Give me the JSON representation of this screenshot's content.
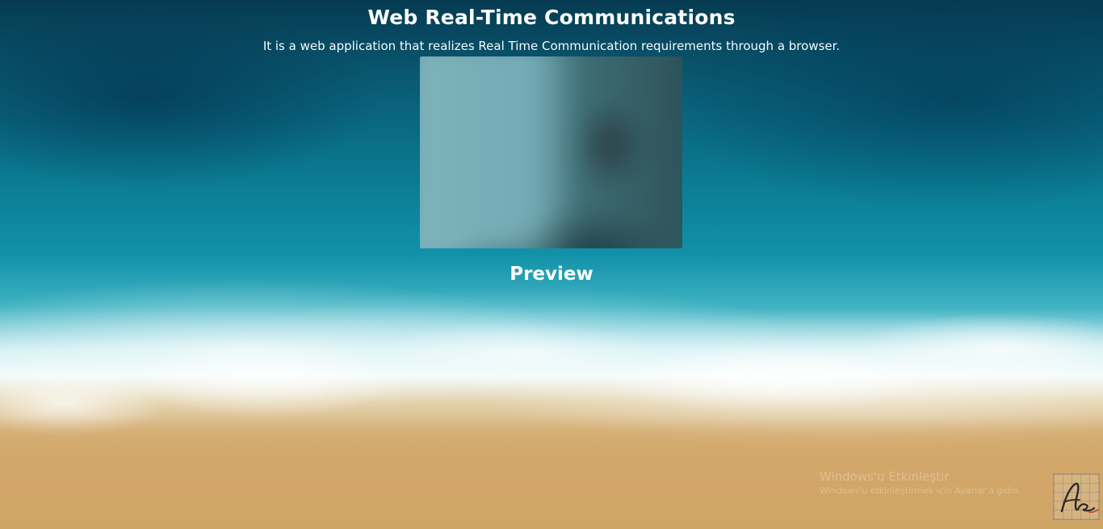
{
  "header": {
    "title": "Web Real-Time Communications",
    "subtitle": "It is a web application that realizes Real Time Communication requirements through a browser."
  },
  "preview": {
    "label": "Preview"
  },
  "watermark": {
    "title": "Windows'u Etkinleştir",
    "subtitle": "Windows'u etkinleştirmek için Ayarlar'a gidin."
  },
  "logo": {
    "icon": "signature-logo-icon"
  },
  "colors": {
    "text": "#ffffff",
    "ocean_deep": "#063b52",
    "ocean_light": "#1191a8",
    "sand": "#d2a86a"
  }
}
